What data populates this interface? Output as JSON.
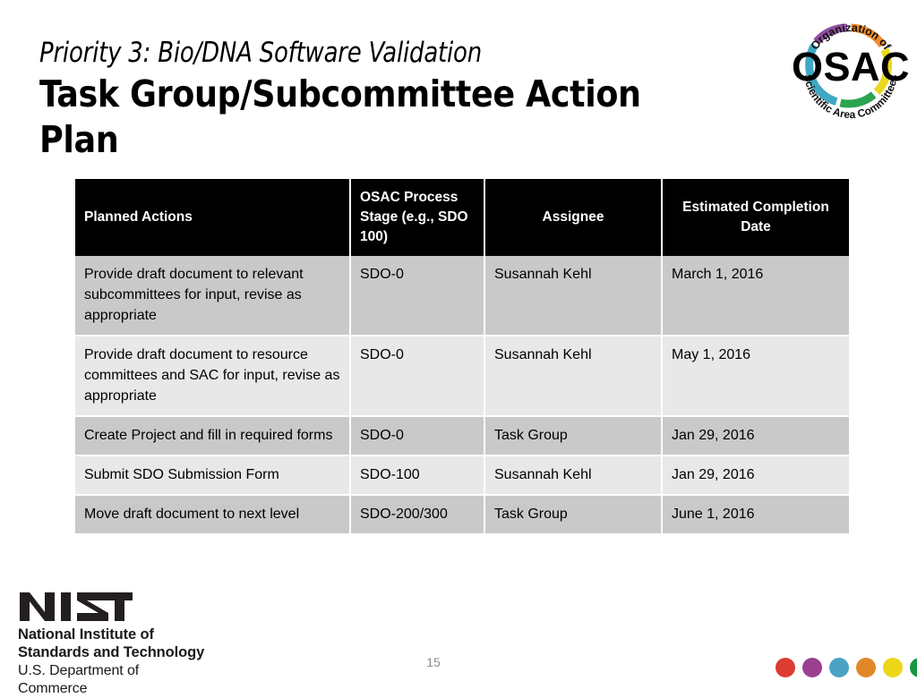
{
  "slide": {
    "subtitle": "Priority 3: Bio/DNA Software Validation",
    "title": "Task Group/Subcommittee Action Plan",
    "page_number": "15"
  },
  "osac_logo": {
    "wordmark": "OSAC",
    "arc_top": "Organization of",
    "arc_bottom": "Scientific Area Committees",
    "ring_colors": {
      "purple": "#8e4e9e",
      "orange": "#ef8b2c",
      "yellow": "#ead81e",
      "green": "#2aa44f",
      "teal": "#3fa9c4"
    }
  },
  "table": {
    "headers": [
      "Planned Actions",
      "OSAC Process Stage (e.g., SDO 100)",
      "Assignee",
      "Estimated Completion Date"
    ],
    "rows": [
      {
        "action": "Provide draft document to relevant subcommittees for input, revise as appropriate",
        "stage": "SDO-0",
        "assignee": "Susannah Kehl",
        "date": "March 1, 2016"
      },
      {
        "action": "Provide draft document to resource committees and SAC for input, revise as appropriate",
        "stage": "SDO-0",
        "assignee": "Susannah Kehl",
        "date": "May 1, 2016"
      },
      {
        "action": "Create Project and fill in required forms",
        "stage": "SDO-0",
        "assignee": "Task Group",
        "date": "Jan 29, 2016"
      },
      {
        "action": "Submit SDO Submission Form",
        "stage": "SDO-100",
        "assignee": "Susannah Kehl",
        "date": "Jan 29, 2016"
      },
      {
        "action": "Move draft document to next level",
        "stage": "SDO-200/300",
        "assignee": "Task Group",
        "date": "June 1, 2016"
      }
    ],
    "header_background": "#000000",
    "row_shade_dark": "#c9c9c9",
    "row_shade_light": "#e8e8e8"
  },
  "nist_logo": {
    "wordmark": "NIST",
    "line1": "National Institute of",
    "line2": "Standards and Technology",
    "line3": "U.S. Department of Commerce"
  },
  "dots": [
    {
      "name": "dot-red",
      "color": "#dc3c32"
    },
    {
      "name": "dot-purple",
      "color": "#9b3f8f"
    },
    {
      "name": "dot-teal",
      "color": "#4ba3c3"
    },
    {
      "name": "dot-orange",
      "color": "#e08828"
    },
    {
      "name": "dot-yellow",
      "color": "#ecd619"
    },
    {
      "name": "dot-green",
      "color": "#1a9641"
    }
  ]
}
